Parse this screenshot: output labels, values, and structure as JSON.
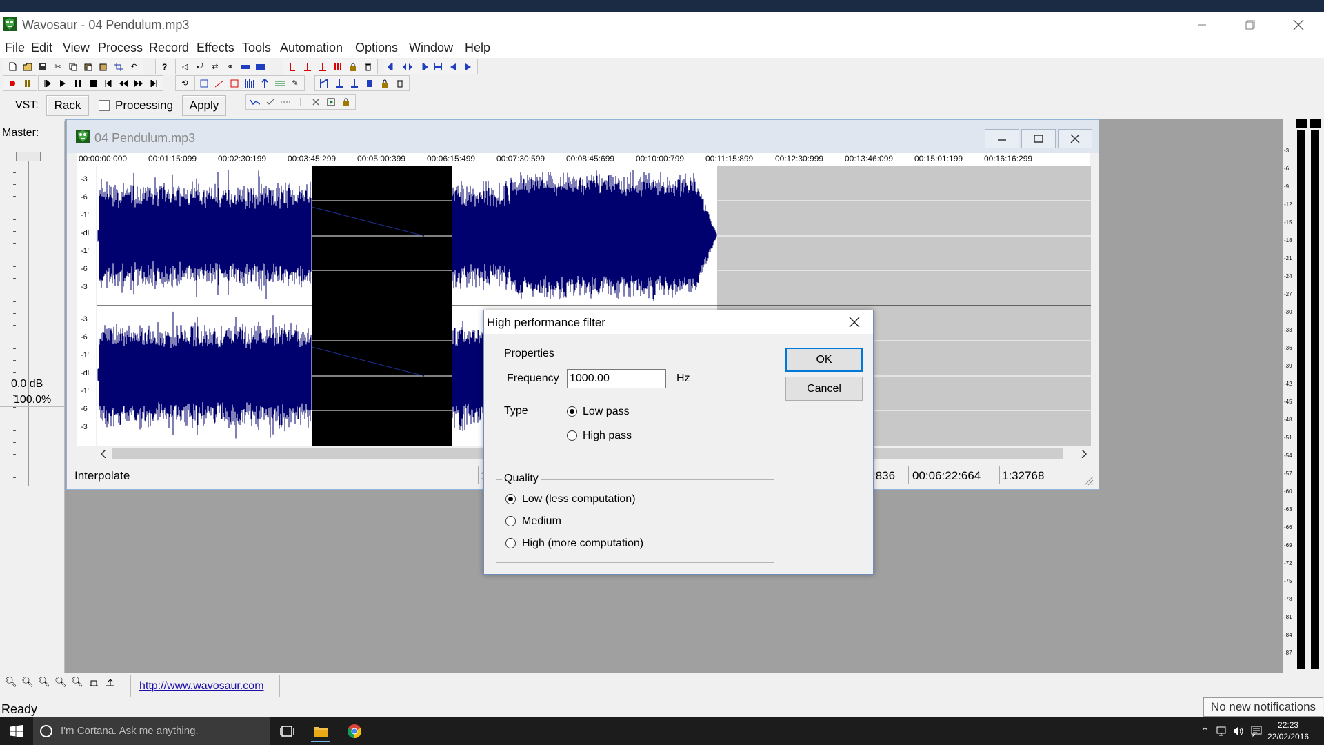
{
  "window": {
    "title": "Wavosaur - 04 Pendulum.mp3"
  },
  "menu": [
    "File",
    "Edit",
    "View",
    "Process",
    "Record",
    "Effects",
    "Tools",
    "Automation",
    "Options",
    "Window",
    "Help"
  ],
  "vst_bar": {
    "vst_label": "VST:",
    "rack_label": "Rack",
    "processing_label": "Processing",
    "processing_checked": false,
    "apply_label": "Apply"
  },
  "master": {
    "label": "Master:",
    "db": "0.0 dB",
    "percent": "100.0%"
  },
  "child_window": {
    "title": "04 Pendulum.mp3",
    "timeline": [
      "00:00:00:000",
      "00:01:15:099",
      "00:02:30:199",
      "00:03:45:299",
      "00:05:00:399",
      "00:06:15:499",
      "00:07:30:599",
      "00:08:45:699",
      "00:10:00:799",
      "00:11:15:899",
      "00:12:30:999",
      "00:13:46:099",
      "00:15:01:199",
      "00:16:16:299"
    ],
    "scale_marks": [
      "-3",
      "-6",
      "-1'",
      "-dl",
      "-1'",
      "-6",
      "-3"
    ],
    "status": {
      "mode": "Interpolate",
      "cell_1": "1",
      "cell_2": ":836",
      "cell_3": "00:06:22:664",
      "cell_4": "1:32768"
    }
  },
  "dialog": {
    "title": "High performance filter",
    "properties_label": "Properties",
    "frequency_label": "Frequency",
    "frequency_value": "1000.00",
    "frequency_unit": "Hz",
    "type_label": "Type",
    "type_options": [
      "Low pass",
      "High pass"
    ],
    "type_selected": 0,
    "quality_label": "Quality",
    "quality_options": [
      "Low (less computation)",
      "Medium",
      "High (more computation)"
    ],
    "quality_selected": 0,
    "ok_label": "OK",
    "cancel_label": "Cancel"
  },
  "vu_marks": [
    "-3",
    "-6",
    "-9",
    "-12",
    "-15",
    "-18",
    "-21",
    "-24",
    "-27",
    "-30",
    "-33",
    "-36",
    "-39",
    "-42",
    "-45",
    "-48",
    "-51",
    "-54",
    "-57",
    "-60",
    "-63",
    "-66",
    "-69",
    "-72",
    "-75",
    "-78",
    "-81",
    "-84",
    "-87"
  ],
  "bottom": {
    "url": "http://www.wavosaur.com",
    "status": "Ready",
    "notification": "No new notifications"
  },
  "taskbar": {
    "cortana_placeholder": "I'm Cortana. Ask me anything.",
    "time": "22:23",
    "date": "22/02/2016"
  },
  "colors": {
    "wave": "#00006e",
    "selection": "#000000",
    "wave_bg": "#c8c8c8",
    "accent": "#0078d7"
  }
}
